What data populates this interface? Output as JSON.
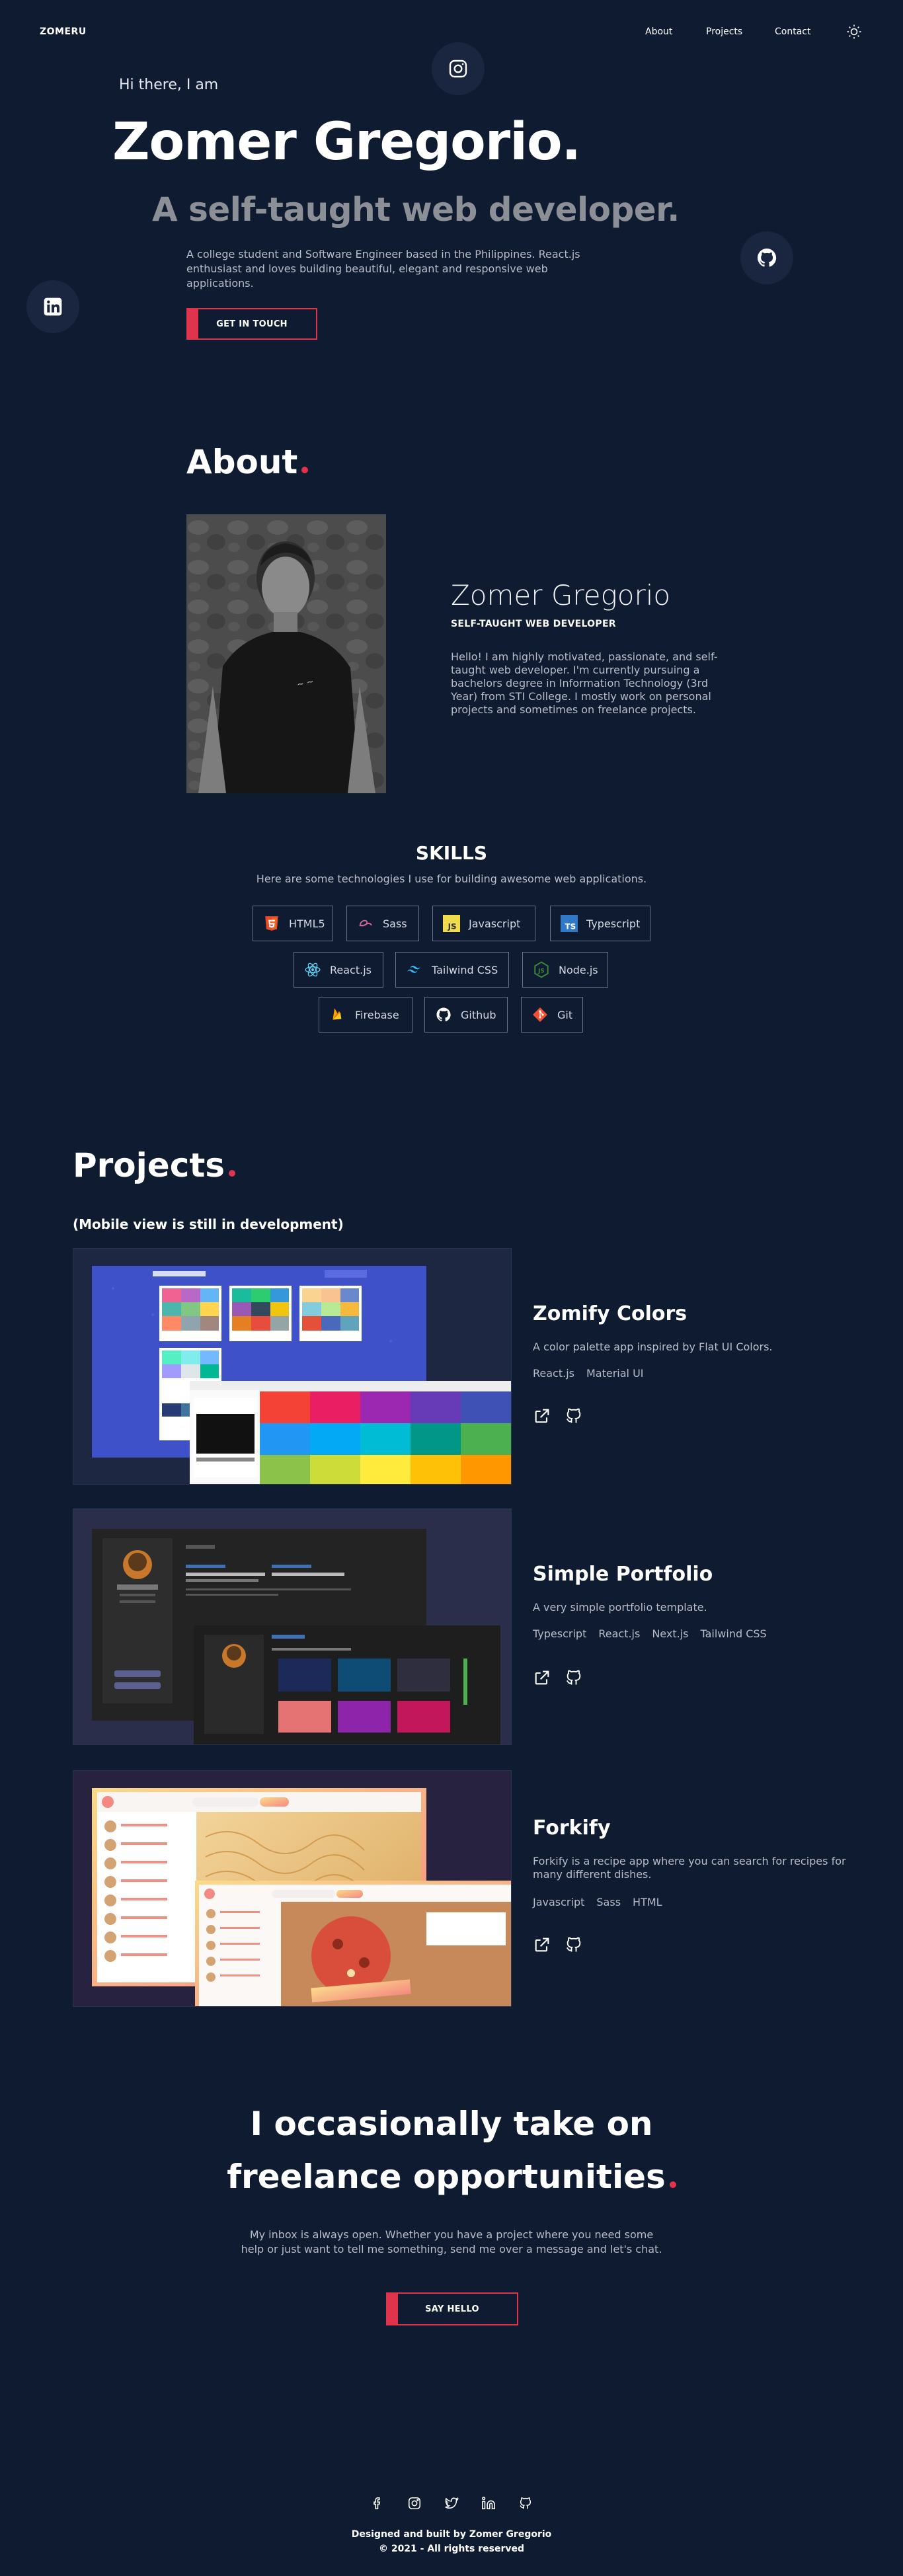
{
  "nav": {
    "logo": "ZOMERU",
    "links": [
      "About",
      "Projects",
      "Contact"
    ]
  },
  "hero": {
    "greeting": "Hi there, I am",
    "name": "Zomer Gregorio.",
    "title": "A self-taught web developer.",
    "description": "A college student and Software Engineer based in the Philippines. React.js enthusiast and loves building beautiful, elegant and responsive web applications.",
    "cta": "GET IN TOUCH"
  },
  "about": {
    "heading": "About",
    "name": "Zomer Gregorio",
    "role": "SELF-TAUGHT WEB DEVELOPER",
    "bio": "Hello! I am highly motivated, passionate, and self-taught web developer. I'm currently pursuing a bachelors degree in Information Technology (3rd Year) from STI College. I mostly work on personal projects and sometimes on freelance projects."
  },
  "skills": {
    "heading": "SKILLS",
    "subheading": "Here are some technologies I use for building awesome web applications.",
    "items": [
      "HTML5",
      "Sass",
      "Javascript",
      "Typescript",
      "React.js",
      "Tailwind CSS",
      "Node.js",
      "Firebase",
      "Github",
      "Git"
    ]
  },
  "projects": {
    "heading": "Projects",
    "note": "(Mobile view is still in development)",
    "items": [
      {
        "name": "Zomify Colors",
        "description": "A color palette app inspired by Flat UI Colors.",
        "tags": [
          "React.js",
          "Material UI"
        ]
      },
      {
        "name": "Simple Portfolio",
        "description": "A very simple portfolio template.",
        "tags": [
          "Typescript",
          "React.js",
          "Next.js",
          "Tailwind CSS"
        ]
      },
      {
        "name": "Forkify",
        "description": "Forkify is a recipe app where you can search for recipes for many different dishes.",
        "tags": [
          "Javascript",
          "Sass",
          "HTML"
        ]
      }
    ]
  },
  "freelance": {
    "line1": "I occasionally take on",
    "line2": "freelance opportunities",
    "description": "My inbox is always open. Whether you have a project where you need some help or just want to tell me something, send me over a message and let's chat.",
    "cta": "SAY HELLO"
  },
  "footer": {
    "credit": "Designed and built by Zomer Gregorio",
    "copyright": "© 2021 - All rights reserved"
  },
  "colors": {
    "background": "#0f1b31",
    "accent": "#e0344c",
    "muted": "#8c8f96"
  },
  "icons": [
    "sun-icon",
    "instagram-icon",
    "github-icon",
    "linkedin-icon",
    "facebook-icon",
    "twitter-icon",
    "external-link-icon"
  ]
}
